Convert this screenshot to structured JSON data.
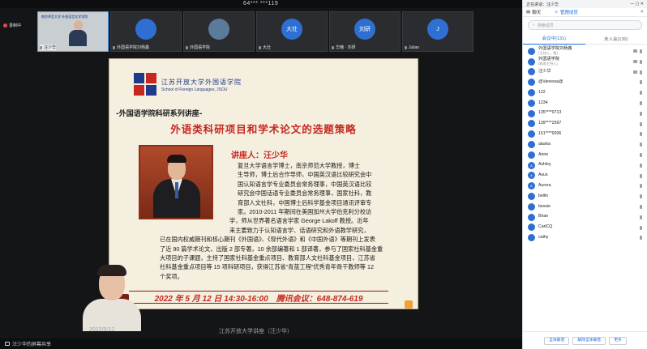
{
  "meeting": {
    "id_text": "64*** ***119",
    "recording_label": "录制中",
    "share_label": "汪少华的屏幕共享",
    "bottom_date": "2022/5/12",
    "bottom_title": "江苏开放大学讲座（汪少华）"
  },
  "tiles": [
    {
      "label": "汪少华",
      "avatar": "",
      "banner": "南京师范大学 外国语言文学学院"
    },
    {
      "label": "外国语学院刘杨鑫",
      "avatar": ""
    },
    {
      "label": "外国语学院",
      "avatar": ""
    },
    {
      "label": "大壮",
      "avatar": "大壮"
    },
    {
      "label": "华楠 · 刘研",
      "avatar": "刘研"
    },
    {
      "label": "Julian",
      "avatar": "J"
    }
  ],
  "slide": {
    "logo_cn": "江苏开放大学外国语学院",
    "logo_en": "School of Foreign Languages, JSOU",
    "series_title": "-外国语学院科研系列讲座-",
    "main_title": "外语类科研项目和学术论文的选题策略",
    "lecturer": "讲座人：汪少华",
    "bio_lines": [
      "复旦大学语言学博士，南京师范大学教授，博士",
      "生导师，博士后合作导师，中国英汉语比较研究会中",
      "国认知语言学专业委员会常务理事，中国英汉语比较",
      "研究会中国话语专业委员会常务理事，国家社科，教",
      "育部人文社科，中国博士后科学基金项目通讯评审专",
      "家。2010-2011 年期间在美国加州大学伯克利分校访",
      "学，师从世界著名语言学家 George Lakoff 教授。近年",
      "来主要致力于认知语言学、话语研究和外语教学研究，",
      "已在国内权威期刊和核心期刊《外国语》、《现代外语》和《中国外语》等期刊上发表",
      "了近 90 篇学术论文，出版 2 部专著，10 余部编著和 1 部译著，参与了国家社科基金重",
      "大项目的子课题，主持了国家社科基金重点项目、教育部人文社科基金项目、江苏省",
      "社科基金重点项目等 15 项科研项目，获得江苏省“青蓝工程”优秀青年骨干教师等 12",
      "个奖项。"
    ],
    "footer_date": "2022 年 5 月 12 日 14:30-16:00",
    "footer_meeting": "腾讯会议：648-874-619"
  },
  "sidebar": {
    "status": "正在讲话：汪少华",
    "tab_chat": "聊天",
    "tab_manage": "管理成员",
    "search_placeholder": "搜索成员",
    "sub_in_meeting": "会议中(131)",
    "sub_not_joined": "未入会(130)",
    "participants": [
      {
        "name": "外国语学院刘杨鑫",
        "role": "(主持人，我)",
        "avatar": ""
      },
      {
        "name": "外国语学院",
        "role": "(联席主持人)",
        "avatar": ""
      },
      {
        "name": "汪少华",
        "role": "",
        "avatar": ""
      },
      {
        "name": "@Vanessa@",
        "role": "",
        "avatar": ""
      },
      {
        "name": "122",
        "role": "",
        "avatar": ""
      },
      {
        "name": "1234",
        "role": "",
        "avatar": ""
      },
      {
        "name": "135****0713",
        "role": "",
        "avatar": ""
      },
      {
        "name": "139****2597",
        "role": "",
        "avatar": ""
      },
      {
        "name": "151****9206",
        "role": "",
        "avatar": ""
      },
      {
        "name": "alaska",
        "role": "",
        "avatar": ""
      },
      {
        "name": "Anne",
        "role": "",
        "avatar": ""
      },
      {
        "name": "Ashley",
        "role": "",
        "avatar": "A"
      },
      {
        "name": "Asus",
        "role": "",
        "avatar": "A"
      },
      {
        "name": "Aurora",
        "role": "",
        "avatar": "A"
      },
      {
        "name": "beilin",
        "role": "",
        "avatar": ""
      },
      {
        "name": "bessie",
        "role": "",
        "avatar": ""
      },
      {
        "name": "Brian",
        "role": "",
        "avatar": ""
      },
      {
        "name": "CarlCQ",
        "role": "",
        "avatar": ""
      },
      {
        "name": "cathy",
        "role": "",
        "avatar": ""
      }
    ],
    "btn_mute_all": "全体静音",
    "btn_unmute_all": "解除全体静音",
    "btn_more": "更多"
  },
  "colors": {
    "accent": "#1a6fe0",
    "title_red": "#c6281f",
    "slide_bg": "#f5efe0",
    "avatar_blue": "#2f6fd2"
  }
}
